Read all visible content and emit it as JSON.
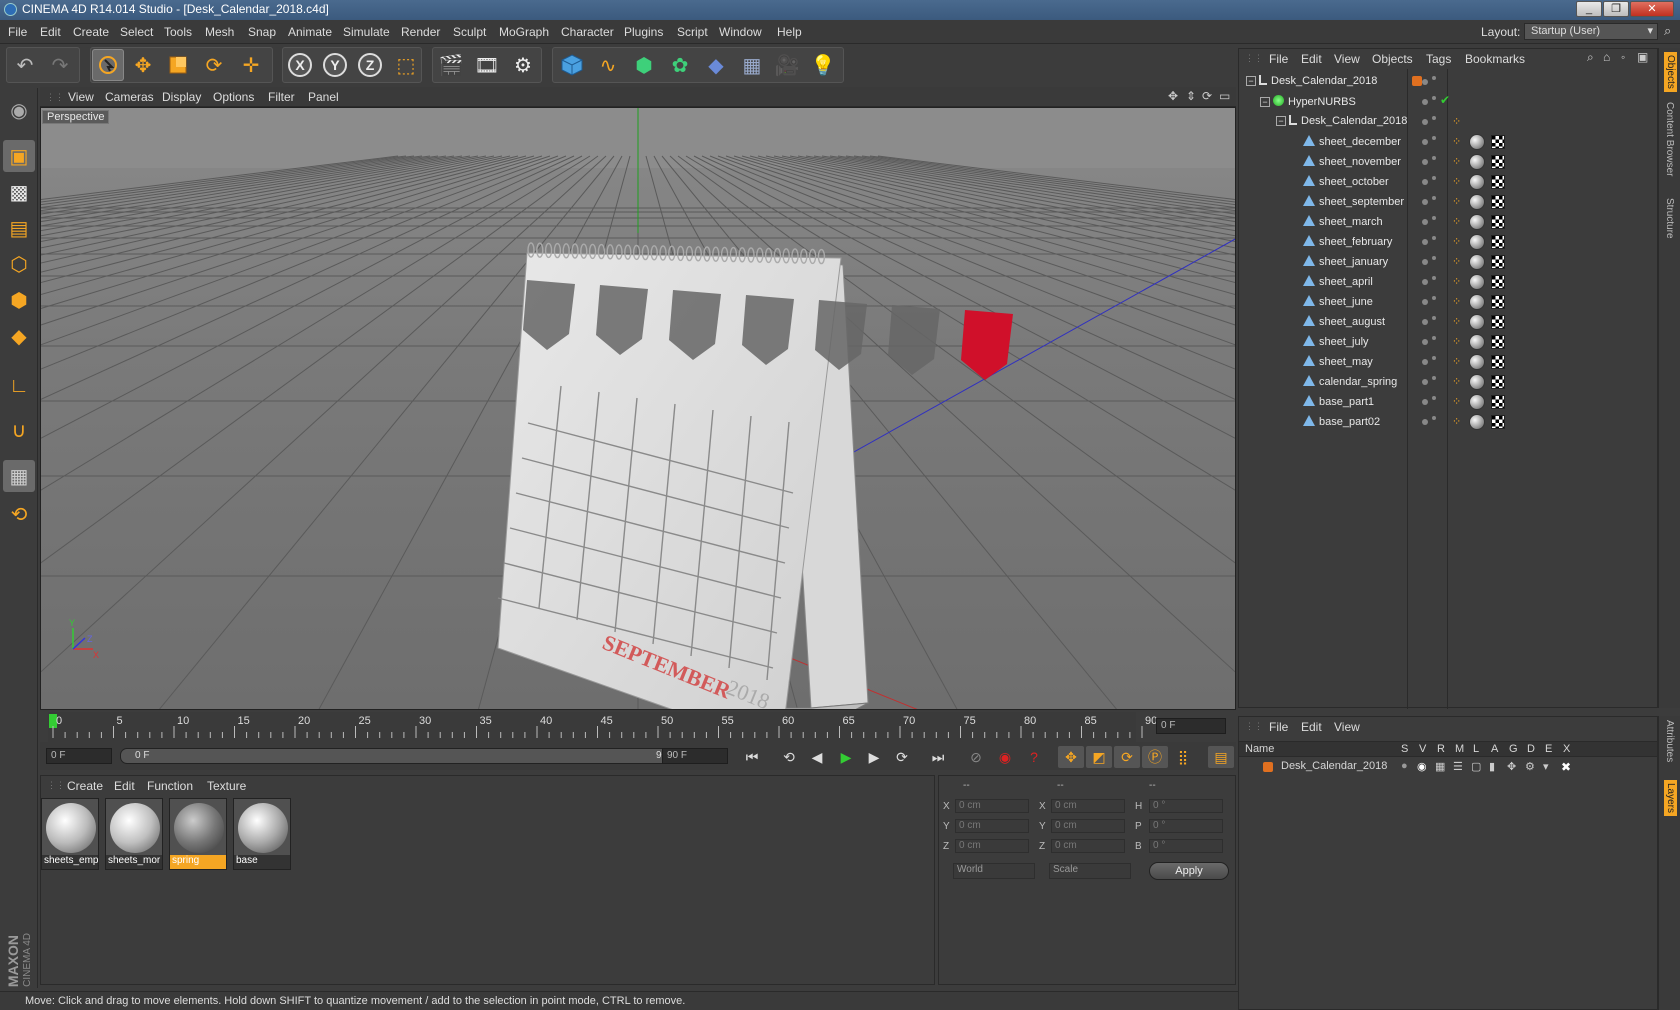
{
  "window": {
    "title": "CINEMA 4D R14.014 Studio - [Desk_Calendar_2018.c4d]",
    "controls": [
      "_",
      "❐",
      "✕"
    ]
  },
  "menu": [
    "File",
    "Edit",
    "Create",
    "Select",
    "Tools",
    "Mesh",
    "Snap",
    "Animate",
    "Simulate",
    "Render",
    "Sculpt",
    "MoGraph",
    "Character",
    "Plugins",
    "Script",
    "Window",
    "Help"
  ],
  "layout": {
    "label": "Layout:",
    "value": "Startup (User)"
  },
  "toolbar_icons": [
    "undo-icon",
    "redo-icon",
    "live-selection-icon",
    "move-icon",
    "scale-icon",
    "rotate-icon",
    "recent-tool-icon",
    "x-axis-icon",
    "y-axis-icon",
    "z-axis-icon",
    "coordinate-system-icon",
    "render-view-icon",
    "render-picture-viewer-icon",
    "render-settings-icon",
    "cube-primitive-icon",
    "spline-icon",
    "nurbs-icon",
    "array-icon",
    "deformer-icon",
    "floor-icon",
    "camera-icon",
    "light-icon"
  ],
  "viewport": {
    "menu": [
      "View",
      "Cameras",
      "Display",
      "Options",
      "Filter",
      "Panel"
    ],
    "label": "Perspective",
    "calendar": {
      "month": "SEPTEMBER",
      "year": "2018"
    },
    "axis": {
      "x": "X",
      "y": "Y",
      "z": "Z"
    }
  },
  "timeline": {
    "ticks": [
      "0",
      "5",
      "10",
      "15",
      "20",
      "25",
      "30",
      "35",
      "40",
      "45",
      "50",
      "55",
      "60",
      "65",
      "70",
      "75",
      "80",
      "85",
      "90"
    ],
    "current": "0 F"
  },
  "transport": {
    "start": "0 F",
    "range_start": "0 F",
    "range_end": "90 F",
    "end": "90 F"
  },
  "materials": {
    "menu": [
      "Create",
      "Edit",
      "Function",
      "Texture"
    ],
    "items": [
      {
        "name": "sheets_emp",
        "selected": false
      },
      {
        "name": "sheets_mor",
        "selected": false
      },
      {
        "name": "spring",
        "selected": true
      },
      {
        "name": "base",
        "selected": false
      }
    ]
  },
  "coords": {
    "headers": [
      "--",
      "--",
      "--"
    ],
    "rows": [
      {
        "a": "X",
        "av": "0 cm",
        "b": "X",
        "bv": "0 cm",
        "c": "H",
        "cv": "0 °"
      },
      {
        "a": "Y",
        "av": "0 cm",
        "b": "Y",
        "bv": "0 cm",
        "c": "P",
        "cv": "0 °"
      },
      {
        "a": "Z",
        "av": "0 cm",
        "b": "Z",
        "bv": "0 cm",
        "c": "B",
        "cv": "0 °"
      }
    ],
    "mode": "World",
    "scale": "Scale",
    "apply": "Apply"
  },
  "objects": {
    "menu": [
      "File",
      "Edit",
      "View",
      "Objects",
      "Tags",
      "Bookmarks"
    ],
    "tree": [
      {
        "name": "Desk_Calendar_2018",
        "level": 0,
        "type": "null"
      },
      {
        "name": "HyperNURBS",
        "level": 1,
        "type": "nurbs"
      },
      {
        "name": "Desk_Calendar_2018",
        "level": 2,
        "type": "null"
      },
      {
        "name": "sheet_december",
        "level": 3,
        "type": "poly"
      },
      {
        "name": "sheet_november",
        "level": 3,
        "type": "poly"
      },
      {
        "name": "sheet_october",
        "level": 3,
        "type": "poly"
      },
      {
        "name": "sheet_september",
        "level": 3,
        "type": "poly"
      },
      {
        "name": "sheet_march",
        "level": 3,
        "type": "poly"
      },
      {
        "name": "sheet_february",
        "level": 3,
        "type": "poly"
      },
      {
        "name": "sheet_january",
        "level": 3,
        "type": "poly"
      },
      {
        "name": "sheet_april",
        "level": 3,
        "type": "poly"
      },
      {
        "name": "sheet_june",
        "level": 3,
        "type": "poly"
      },
      {
        "name": "sheet_august",
        "level": 3,
        "type": "poly"
      },
      {
        "name": "sheet_july",
        "level": 3,
        "type": "poly"
      },
      {
        "name": "sheet_may",
        "level": 3,
        "type": "poly"
      },
      {
        "name": "calendar_spring",
        "level": 3,
        "type": "poly"
      },
      {
        "name": "base_part1",
        "level": 3,
        "type": "poly"
      },
      {
        "name": "base_part02",
        "level": 3,
        "type": "poly"
      }
    ]
  },
  "side_tabs": [
    "Objects",
    "Content Browser",
    "Structure"
  ],
  "layers": {
    "menu": [
      "File",
      "Edit",
      "View"
    ],
    "columns": [
      "Name",
      "S",
      "V",
      "R",
      "M",
      "L",
      "A",
      "G",
      "D",
      "E",
      "X"
    ],
    "rows": [
      {
        "name": "Desk_Calendar_2018",
        "color": "#e07020"
      }
    ]
  },
  "layer_side_tabs": [
    "Attributes",
    "Layers"
  ],
  "branding": {
    "maxon": "MAXON",
    "product": "CINEMA 4D"
  },
  "status": "Move: Click and drag to move elements. Hold down SHIFT to quantize movement / add to the selection in point mode, CTRL to remove.",
  "colors": {
    "accent": "#f5a623",
    "selected_material": "#f5a623",
    "red_tag": "#d0102a"
  }
}
